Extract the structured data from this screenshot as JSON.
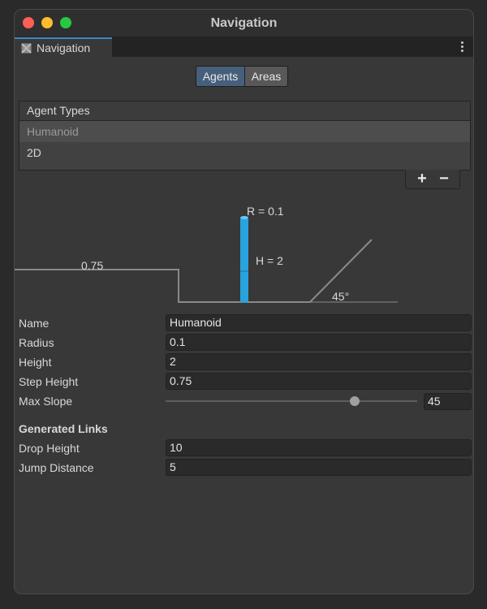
{
  "window": {
    "title": "Navigation"
  },
  "tab": {
    "label": "Navigation",
    "icon": "navmesh-icon"
  },
  "segments": {
    "agents": "Agents",
    "areas": "Areas",
    "selected": "Agents"
  },
  "agent_types": {
    "header": "Agent Types",
    "items": [
      {
        "label": "Humanoid",
        "selected": true
      },
      {
        "label": "2D",
        "selected": false
      }
    ],
    "add_label": "+",
    "remove_label": "−"
  },
  "diagram": {
    "radius_label": "R = 0.1",
    "height_label": "H = 2",
    "step_label": "0.75",
    "slope_label": "45°",
    "agent_color": "#29a3dd"
  },
  "fields": {
    "name": {
      "label": "Name",
      "value": "Humanoid"
    },
    "radius": {
      "label": "Radius",
      "value": "0.1"
    },
    "height": {
      "label": "Height",
      "value": "2"
    },
    "step_height": {
      "label": "Step Height",
      "value": "0.75"
    },
    "max_slope": {
      "label": "Max Slope",
      "value": "45",
      "slider_fraction": 0.75
    }
  },
  "generated_links": {
    "header": "Generated Links",
    "drop_height": {
      "label": "Drop Height",
      "value": "10"
    },
    "jump_distance": {
      "label": "Jump Distance",
      "value": "5"
    }
  }
}
